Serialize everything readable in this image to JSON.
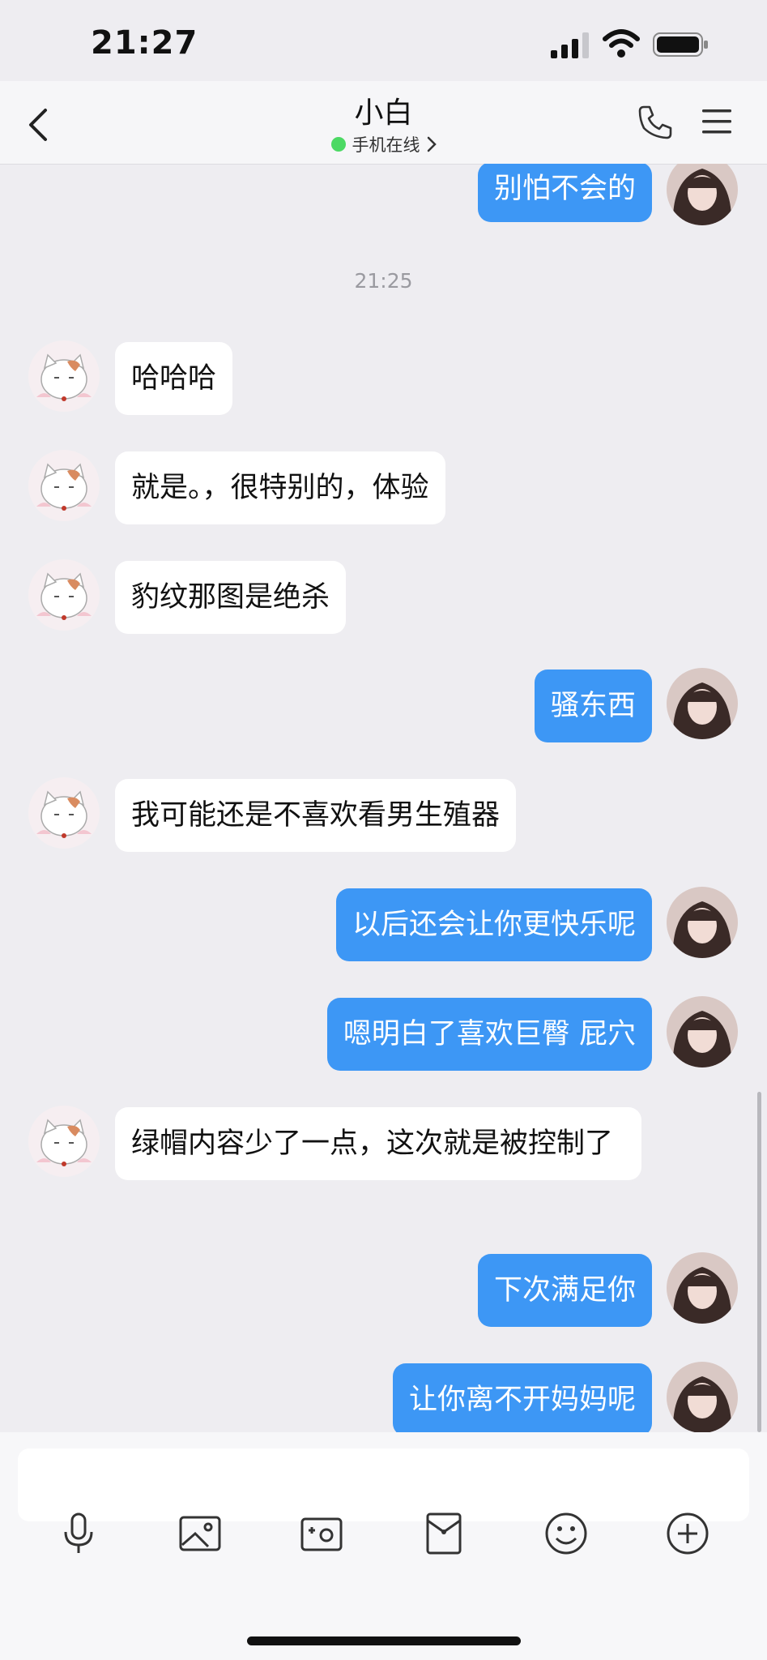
{
  "status_bar": {
    "time": "21:27"
  },
  "header": {
    "title": "小白",
    "status_text": "手机在线"
  },
  "messages": [
    {
      "id": 0,
      "side": "right",
      "text": "别怕不会的"
    },
    {
      "id": 1,
      "type": "timestamp",
      "text": "21:25"
    },
    {
      "id": 2,
      "side": "left",
      "text": "哈哈哈"
    },
    {
      "id": 3,
      "side": "left",
      "text": "就是。，很特别的，体验"
    },
    {
      "id": 4,
      "side": "left",
      "text": "豹纹那图是绝杀"
    },
    {
      "id": 5,
      "side": "right",
      "text": "骚东西"
    },
    {
      "id": 6,
      "side": "left",
      "text": "我可能还是不喜欢看男生殖器"
    },
    {
      "id": 7,
      "side": "right",
      "text": "以后还会让你更快乐呢"
    },
    {
      "id": 8,
      "side": "right",
      "text": "嗯明白了喜欢巨臀 屁穴"
    },
    {
      "id": 9,
      "side": "left",
      "text": "绿帽内容少了一点，这次就是被控制了"
    },
    {
      "id": 10,
      "side": "right",
      "text": "下次满足你"
    },
    {
      "id": 11,
      "side": "right",
      "text": "让你离不开妈妈呢"
    }
  ],
  "input": {
    "value": ""
  },
  "toolbar": {
    "icons": [
      "microphone-icon",
      "image-icon",
      "camera-icon",
      "red-packet-icon",
      "emoji-icon",
      "plus-icon"
    ]
  },
  "colors": {
    "accent": "#3d97f5",
    "background": "#eeedf1",
    "online": "#4cd964"
  }
}
